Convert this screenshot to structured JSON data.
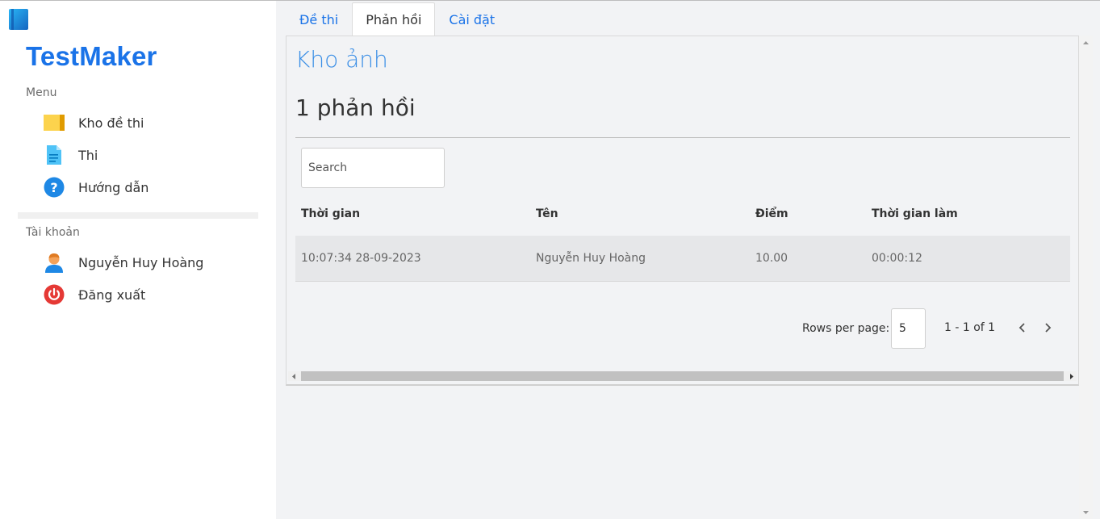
{
  "app": {
    "brand": "TestMaker"
  },
  "sidebar": {
    "menu_label": "Menu",
    "menu_items": [
      {
        "label": "Kho đề thi",
        "icon": "folder-icon"
      },
      {
        "label": "Thi",
        "icon": "document-icon"
      },
      {
        "label": "Hướng dẫn",
        "icon": "help-icon"
      }
    ],
    "account_label": "Tài khoản",
    "account_items": [
      {
        "label": "Nguyễn Huy Hoàng",
        "icon": "user-icon"
      },
      {
        "label": "Đăng xuất",
        "icon": "power-icon"
      }
    ]
  },
  "tabs": [
    {
      "label": "Đề thi",
      "active": false
    },
    {
      "label": "Phản hồi",
      "active": true
    },
    {
      "label": "Cài đặt",
      "active": false
    }
  ],
  "panel": {
    "title": "Kho ảnh",
    "count_text": "1 phản hồi",
    "search_placeholder": "Search",
    "columns": [
      "Thời gian",
      "Tên",
      "Điểm",
      "Thời gian làm"
    ],
    "rows": [
      {
        "time": "10:07:34 28-09-2023",
        "name": "Nguyễn Huy Hoàng",
        "score": "10.00",
        "duration": "00:00:12"
      }
    ],
    "pagination": {
      "rows_per_page_label": "Rows per page:",
      "rows_per_page": "5",
      "range": "1 - 1 of 1"
    }
  },
  "colors": {
    "accent": "#1a73e8",
    "title_blue": "#3c8fe6",
    "background": "#f2f3f5"
  }
}
